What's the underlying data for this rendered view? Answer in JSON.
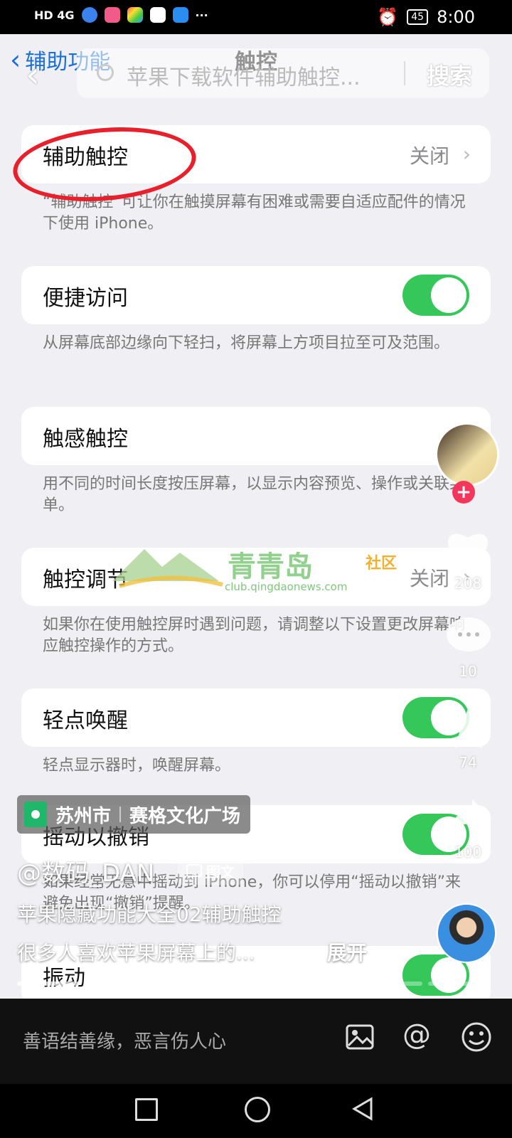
{
  "status_bar": {
    "network": "HD 4G",
    "battery": "45",
    "time": "8:00",
    "more": "···"
  },
  "nav": {
    "back_label": "辅助功能",
    "title": "触控",
    "search_placeholder": "苹果下载软件辅助触控...",
    "search_button": "搜索"
  },
  "settings": [
    {
      "label": "辅助触控",
      "value": "关闭",
      "description": "“辅助触控”可让你在触摸屏幕有困难或需要自适应配件的情况下使用 iPhone。"
    },
    {
      "label": "便捷访问",
      "toggle": "on",
      "description": "从屏幕底部边缘向下轻扫，将屏幕上方项目拉至可及范围。"
    },
    {
      "label": "触感触控",
      "description": "用不同的时间长度按压屏幕，以显示内容预览、操作或关联菜单。"
    },
    {
      "label": "触控调节",
      "value": "关闭",
      "description": "如果你在使用触控屏时遇到问题，请调整以下设置更改屏幕响应触控操作的方式。"
    },
    {
      "label": "轻点唤醒",
      "toggle": "on",
      "description": "轻点显示器时，唤醒屏幕。"
    },
    {
      "label": "摇动以撤销",
      "toggle": "on",
      "description": "如果经常无意中摇动到 iPhone，你可以停用“摇动以撤销”来避免出现“撤销”提醒。"
    },
    {
      "label": "振动",
      "toggle": "on"
    }
  ],
  "watermark": {
    "brand": "青青岛",
    "sub": "社区",
    "url": "club.qingdaonews.com"
  },
  "side_actions": {
    "likes": "208",
    "comments": "10",
    "favorites": "74",
    "shares": "100"
  },
  "location": {
    "city": "苏州市",
    "place": "赛格文化广场"
  },
  "post": {
    "author": "@数码_DAN",
    "tag": "图文",
    "title": "苹果隐藏功能大全02辅助触控",
    "excerpt": "很多人喜欢苹果屏幕上的...",
    "expand": "展开"
  },
  "comment_bar": {
    "placeholder": "善语结善缘，恶言伤人心"
  },
  "colors": {
    "accent_ios_blue": "#1a6fd8",
    "toggle_green": "#35c759",
    "like_red": "#f5365c",
    "highlight_red": "#e8202b"
  }
}
